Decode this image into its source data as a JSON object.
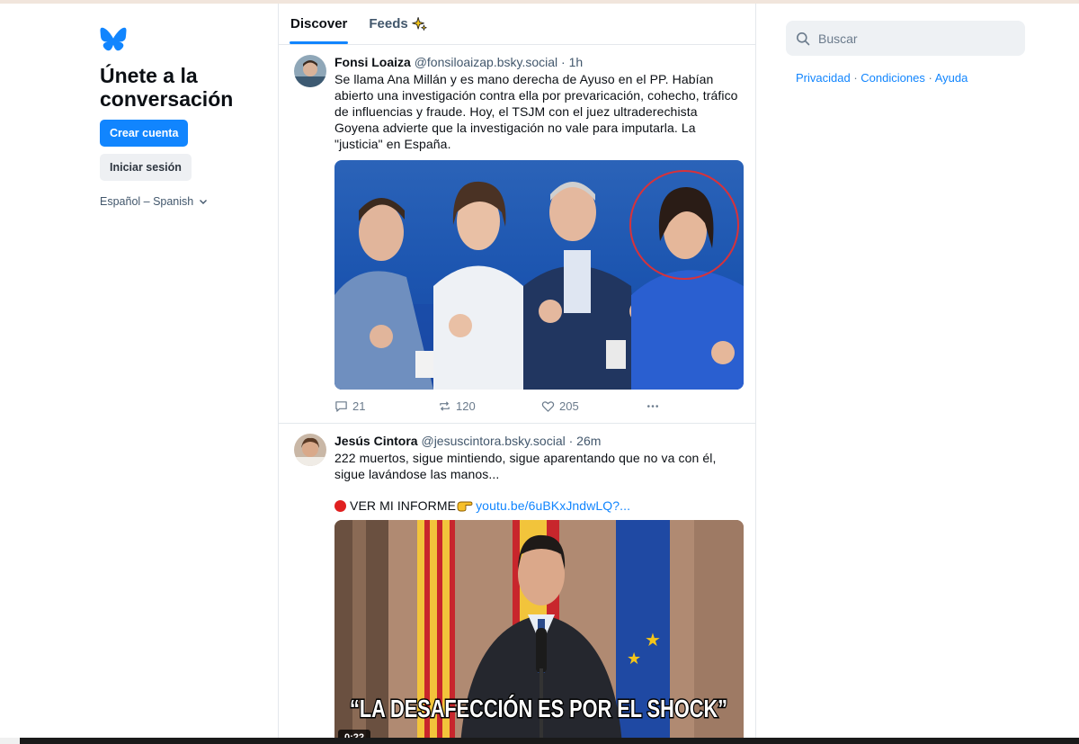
{
  "left": {
    "tagline": "Únete a la conversación",
    "create_account": "Crear cuenta",
    "sign_in": "Iniciar sesión",
    "language": "Español – Spanish"
  },
  "tabs": [
    {
      "label": "Discover",
      "active": true
    },
    {
      "label": "Feeds",
      "active": false,
      "icon": "sparkle-icon"
    }
  ],
  "posts": [
    {
      "author": "Fonsi Loaiza",
      "handle": "@fonsiloaizap.bsky.social",
      "time": "· 1h",
      "text": "Se llama Ana Millán y es mano derecha de Ayuso en el PP. Habían abierto una investigación contra ella por prevaricación, cohecho, tráfico de influencias y fraude. Hoy, el TSJM con el juez ultraderechista Goyena advierte que la investigación no vale para imputarla. La \"justicia\" en España.",
      "replies": "21",
      "reposts": "120",
      "likes": "205"
    },
    {
      "author": "Jesús Cintora",
      "handle": "@jesuscintora.bsky.social",
      "time": "· 26m",
      "text": "222 muertos, sigue mintiendo, sigue aparentando que no va con él, sigue lavándose las manos...",
      "cta": "VER MI INFORME",
      "link": "youtu.be/6uBKxJndwLQ?...",
      "video_caption": "“LA DESAFECCIÓN ES POR EL SHOCK”",
      "video_time": "0:22"
    }
  ],
  "right": {
    "search_placeholder": "Buscar",
    "links": [
      "Privacidad",
      "Condiciones",
      "Ayuda"
    ],
    "separator": "·"
  },
  "colors": {
    "accent": "#1185fe",
    "muted": "#42576c",
    "border": "#e4e8ec"
  }
}
